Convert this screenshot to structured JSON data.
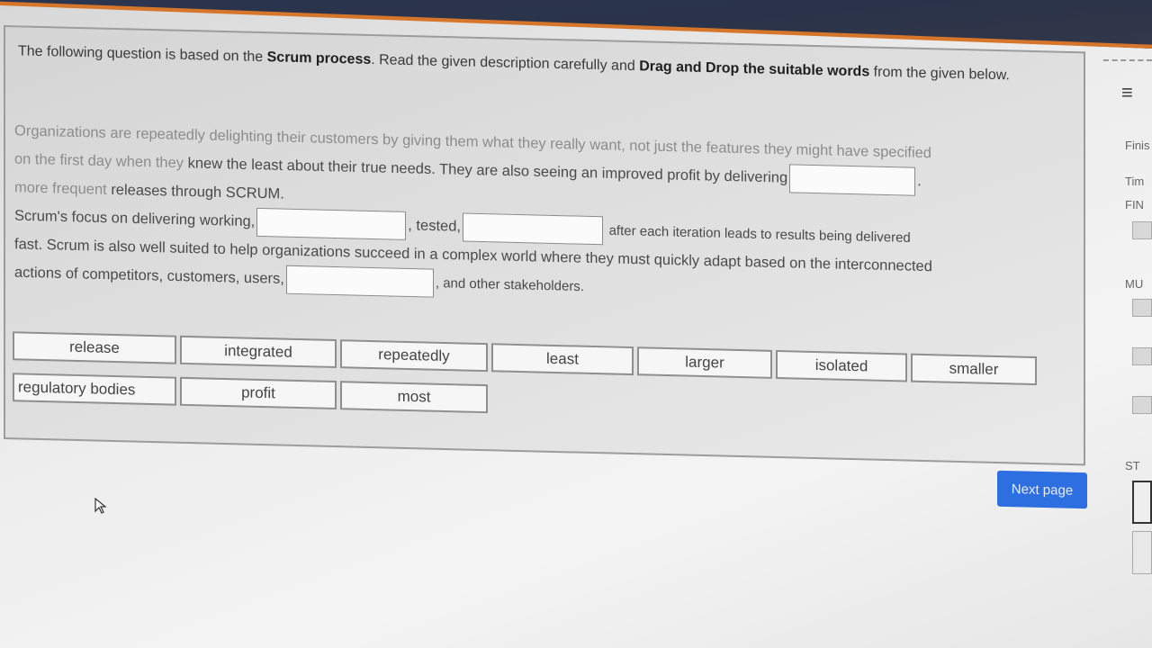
{
  "question": {
    "instruction_pre": "The following question is based on the ",
    "instruction_bold1": "Scrum process",
    "instruction_mid": ". Read the given description carefully and ",
    "instruction_bold2": "Drag and Drop the suitable words",
    "instruction_post": " from the given below."
  },
  "passage": {
    "line1": "Organizations are repeatedly delighting their customers by giving them what they really want, not just the features they might have specified",
    "line2_faded": "on the first day when they ",
    "line2": "knew the least about their true needs. They are also seeing an improved profit by delivering",
    "line3_faded": "more frequent ",
    "line3": "releases through SCRUM.",
    "line4_pre": "Scrum's focus on delivering working,",
    "line4_mid": ", tested,",
    "line4_post": "after each iteration leads to results being delivered",
    "line5": "fast. Scrum is also well suited to help organizations succeed in a complex world where they must quickly adapt based on the interconnected",
    "line6_pre": "actions of competitors, customers, users,",
    "line6_post": ", and other stakeholders."
  },
  "word_bank": {
    "row1": [
      "release",
      "integrated",
      "repeatedly",
      "least",
      "larger",
      "isolated",
      "smaller"
    ],
    "row2": [
      "regulatory bodies",
      "profit",
      "most"
    ]
  },
  "next_button": {
    "label": "Next page"
  },
  "side_panel": {
    "finish_label": "Finis",
    "time_label": "Tim",
    "final_label": "FIN",
    "mu_label": "MU",
    "st_label": "ST"
  }
}
